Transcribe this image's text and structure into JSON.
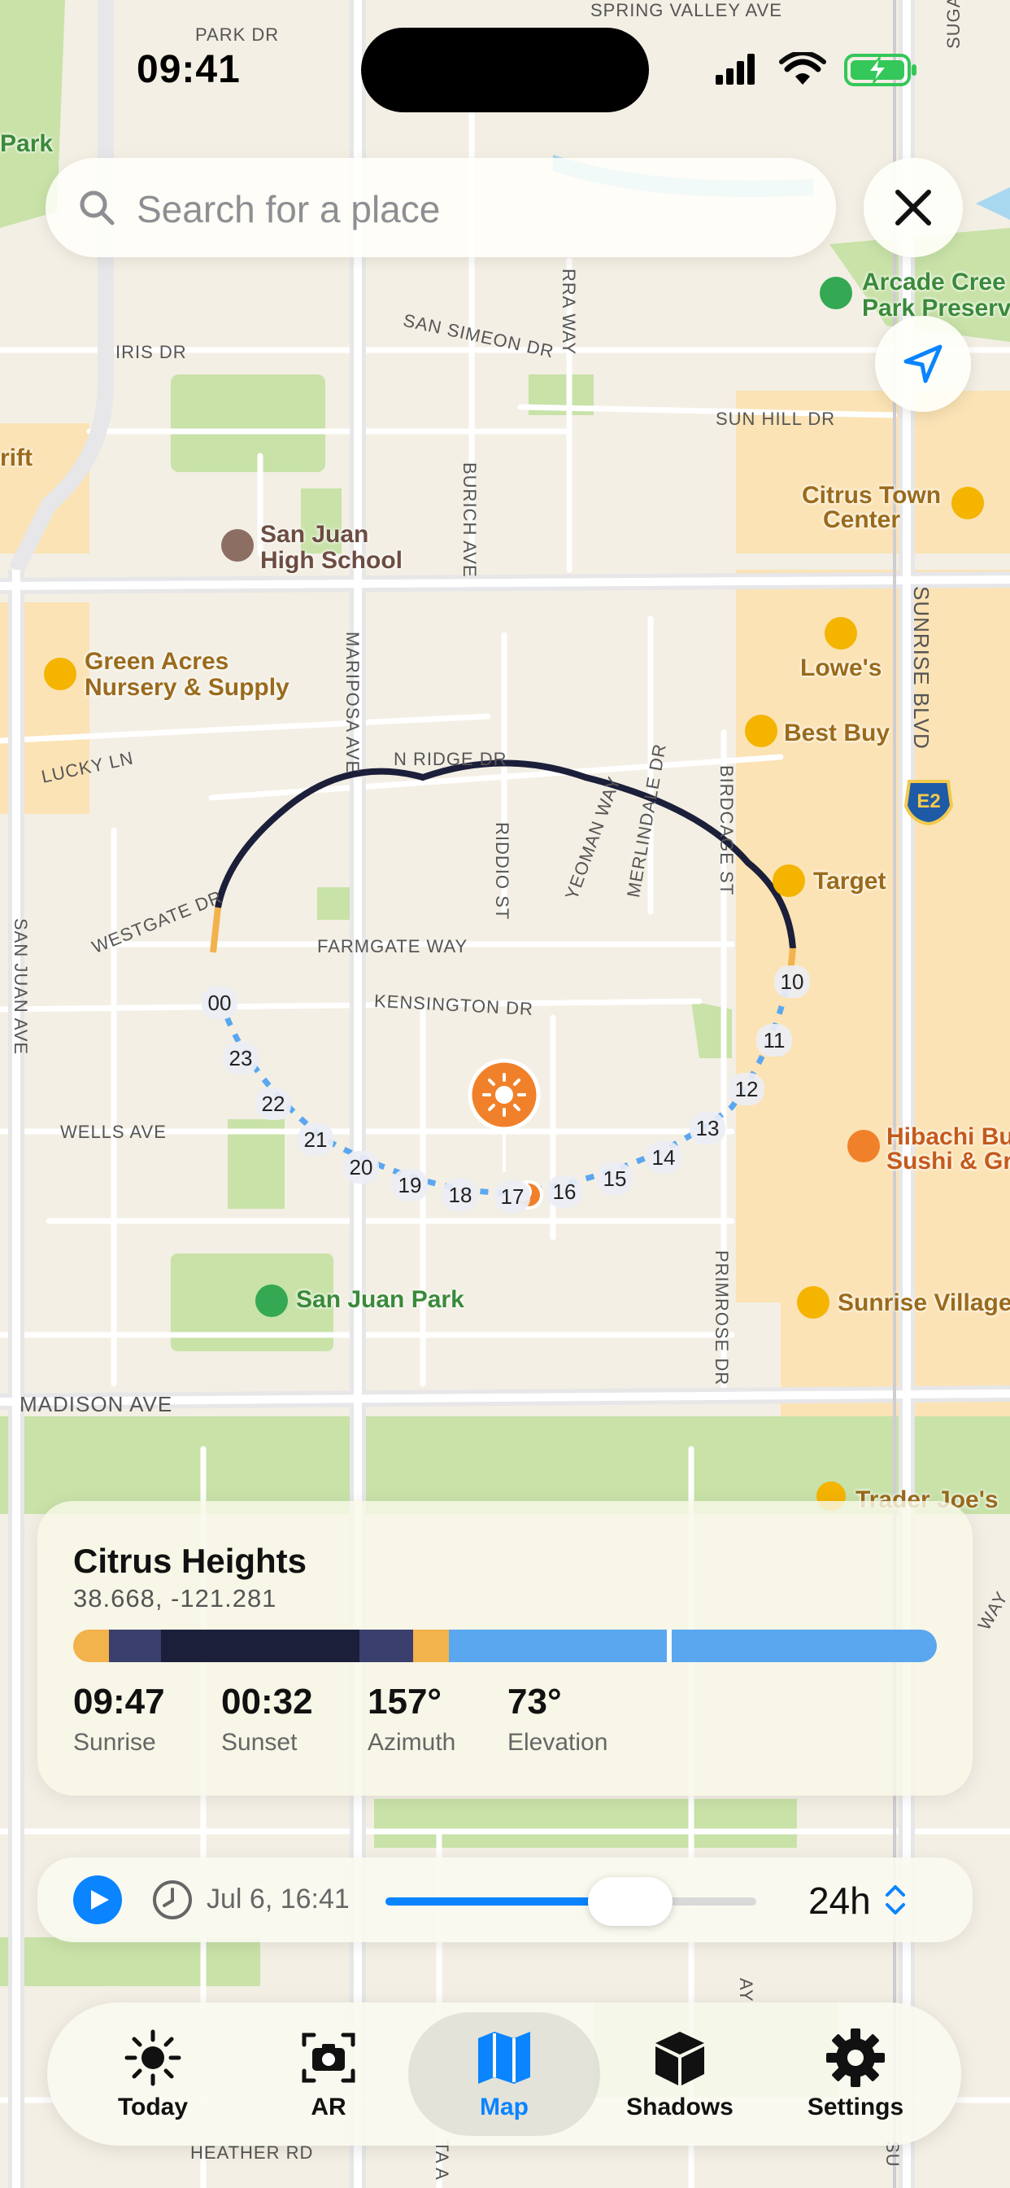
{
  "status": {
    "time": "09:41"
  },
  "search": {
    "placeholder": "Search for a place"
  },
  "map_labels": {
    "streets": [
      "PARK DR",
      "SPRING VALLEY AVE",
      "SUGAR M",
      "IRIS DR",
      "SAN SIMEON DR",
      "RRA WAY",
      "SUN HILL DR",
      "BURICH AVE",
      "SUNRISE BLVD",
      "MARIPOSA AVE",
      "N RIDGE DR",
      "LUCKY LN",
      "WESTGATE DR",
      "RIDDIO ST",
      "YEOMAN WAY",
      "MERLINDALE DR",
      "BIRDCAGE ST",
      "FARMGATE WAY",
      "KENSINGTON DR",
      "SAN JUAN AVE",
      "WELLS AVE",
      "PRIMROSE DR",
      "MADISON AVE",
      "HEATHER RD",
      "WAY",
      "AY",
      "TA A",
      "SU"
    ],
    "pois": [
      "Park",
      "Arcade Cree",
      "Park Preserv",
      "Citrus Town",
      "Center",
      "rift",
      "San Juan",
      "High School",
      "Green Acres",
      "Nursery & Supply",
      "Lowe's",
      "Best Buy",
      "Target",
      "Hibachi Bu",
      "Sushi & Gri",
      "San Juan Park",
      "Sunrise Village",
      "Trader Joe's"
    ],
    "shield": "E2"
  },
  "sun_path": {
    "hours": [
      "00",
      "23",
      "22",
      "21",
      "20",
      "19",
      "18",
      "17",
      "16",
      "15",
      "14",
      "13",
      "12",
      "11",
      "10"
    ]
  },
  "location_card": {
    "title": "Citrus Heights",
    "coords": "38.668, -121.281",
    "sunrise_value": "09:47",
    "sunrise_label": "Sunrise",
    "sunset_value": "00:32",
    "sunset_label": "Sunset",
    "azimuth_value": "157°",
    "azimuth_label": "Azimuth",
    "elevation_value": "73°",
    "elevation_label": "Elevation"
  },
  "time_control": {
    "datetime": "Jul 6, 16:41",
    "range": "24h",
    "slider_fraction": 0.66
  },
  "tabs": [
    {
      "label": "Today",
      "icon": "sun-icon"
    },
    {
      "label": "AR",
      "icon": "camera-icon"
    },
    {
      "label": "Map",
      "icon": "map-icon"
    },
    {
      "label": "Shadows",
      "icon": "cube-icon"
    },
    {
      "label": "Settings",
      "icon": "gear-icon"
    }
  ],
  "colors": {
    "accent": "#0a84ff",
    "sun_orange": "#f0812a",
    "night": "#1c1f3a",
    "twilight": "#3a3f6e",
    "golden": "#f2b24c",
    "day": "#5aa7f0",
    "park_green": "#c8e2a8",
    "commercial": "#fbe3b5"
  },
  "active_tab": "Map"
}
